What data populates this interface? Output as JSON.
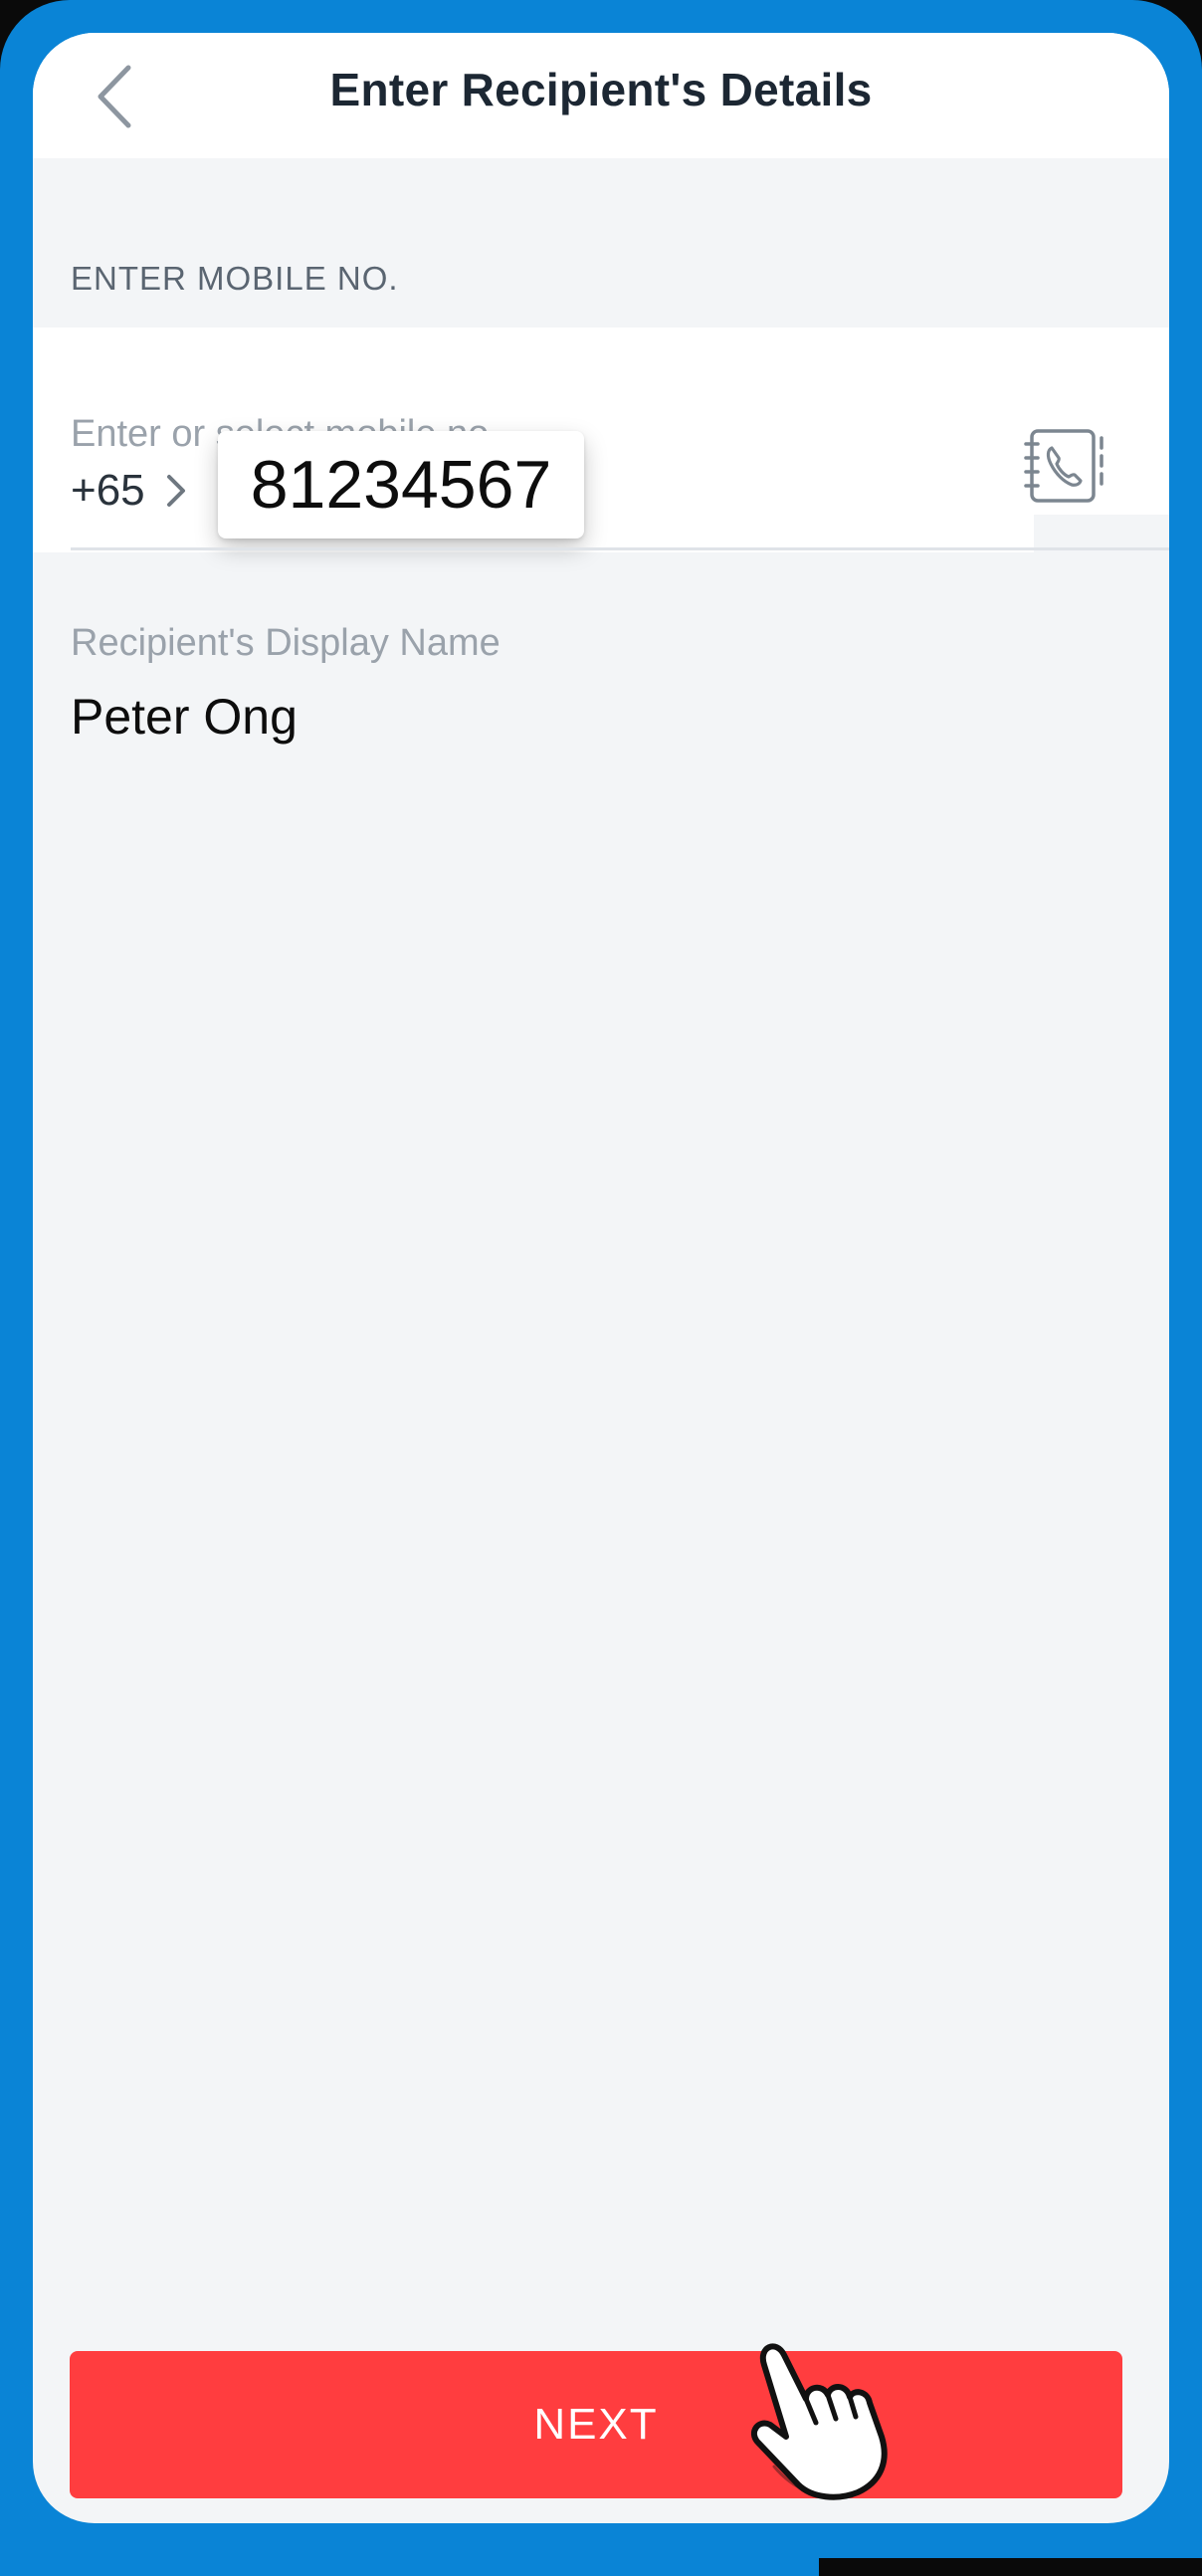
{
  "header": {
    "title": "Enter Recipient's Details",
    "back_icon": "chevron-left-icon"
  },
  "mobile_section": {
    "label": "ENTER MOBILE NO.",
    "placeholder": "Enter or select mobile no.",
    "country_code": "+65",
    "number": "81234567",
    "contacts_icon": "address-book-phone-icon"
  },
  "display_name": {
    "label": "Recipient's Display Name",
    "value": "Peter Ong"
  },
  "footer": {
    "next_label": "NEXT"
  },
  "colors": {
    "frame": "#0a84d6",
    "next_button": "#ff3d3f",
    "background": "#f3f5f7"
  }
}
